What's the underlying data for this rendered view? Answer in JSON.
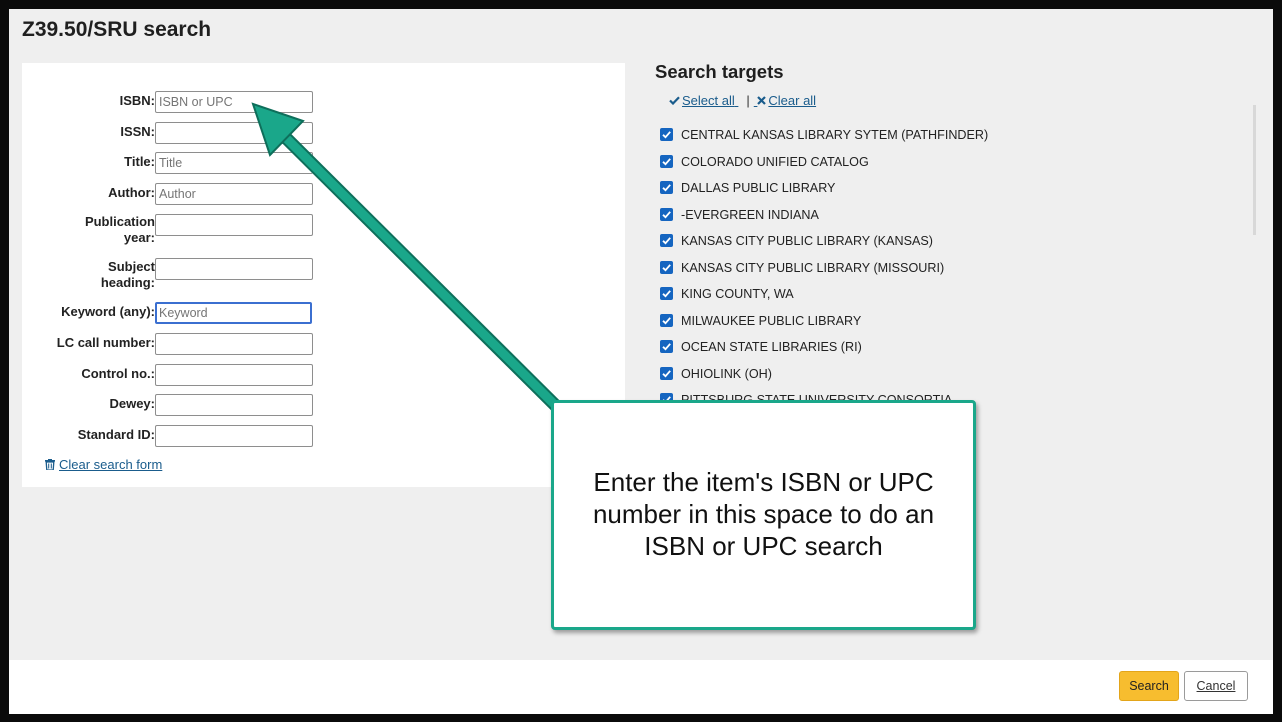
{
  "dialog": {
    "title": "Z39.50/SRU search"
  },
  "form": {
    "fields": [
      {
        "label": "ISBN:",
        "value": "",
        "placeholder": "ISBN or UPC"
      },
      {
        "label": "ISSN:",
        "value": "",
        "placeholder": ""
      },
      {
        "label": "Title:",
        "value": "",
        "placeholder": "Title"
      },
      {
        "label": "Author:",
        "value": "",
        "placeholder": "Author"
      },
      {
        "label": "Publication year:",
        "value": "",
        "placeholder": ""
      },
      {
        "label": "Subject heading:",
        "value": "",
        "placeholder": ""
      },
      {
        "label": "Keyword (any):",
        "value": "",
        "placeholder": "Keyword"
      },
      {
        "label": "LC call number:",
        "value": "",
        "placeholder": ""
      },
      {
        "label": "Control no.:",
        "value": "",
        "placeholder": ""
      },
      {
        "label": "Dewey:",
        "value": "",
        "placeholder": ""
      },
      {
        "label": "Standard ID:",
        "value": "",
        "placeholder": ""
      }
    ],
    "clear_label": "Clear search form"
  },
  "targets": {
    "heading": "Search targets",
    "select_all": "Select all",
    "separator": "|",
    "clear_all": "Clear all",
    "items": [
      {
        "label": "CENTRAL KANSAS LIBRARY SYTEM (PATHFINDER)",
        "checked": true
      },
      {
        "label": "COLORADO UNIFIED CATALOG",
        "checked": true
      },
      {
        "label": "DALLAS PUBLIC LIBRARY",
        "checked": true
      },
      {
        "label": "-EVERGREEN INDIANA",
        "checked": true
      },
      {
        "label": "KANSAS CITY PUBLIC LIBRARY (KANSAS)",
        "checked": true
      },
      {
        "label": "KANSAS CITY PUBLIC LIBRARY (MISSOURI)",
        "checked": true
      },
      {
        "label": "KING COUNTY, WA",
        "checked": true
      },
      {
        "label": "MILWAUKEE PUBLIC LIBRARY",
        "checked": true
      },
      {
        "label": "OCEAN STATE LIBRARIES (RI)",
        "checked": true
      },
      {
        "label": "OHIOLINK (OH)",
        "checked": true
      },
      {
        "label": "PITTSBURG STATE UNIVERSITY CONSORTIA",
        "checked": true
      }
    ]
  },
  "footer": {
    "search_label": "Search",
    "cancel_label": "Cancel"
  },
  "callout": {
    "text": "Enter the item's ISBN or UPC number in this space to do an ISBN or UPC search"
  },
  "colors": {
    "accent_teal": "#1aa78a",
    "search_button": "#f7bd2f",
    "checkbox": "#1565c0",
    "link": "#1a5c8c"
  }
}
